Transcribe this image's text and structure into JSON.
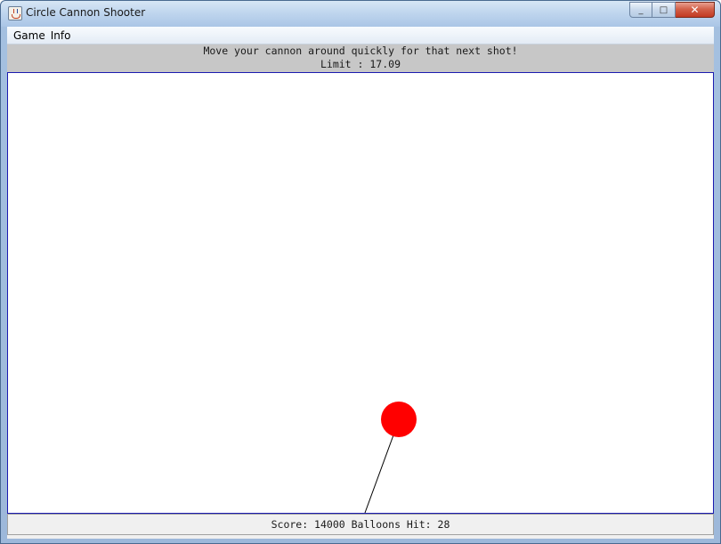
{
  "window": {
    "title": "Circle Cannon Shooter",
    "minimize_glyph": "_",
    "maximize_glyph": "□",
    "close_glyph": "✕"
  },
  "menu": {
    "items": [
      {
        "label": "Game"
      },
      {
        "label": "Info"
      }
    ]
  },
  "header": {
    "message": "Move your cannon around quickly for that next shot!",
    "limit_label": "Limit",
    "limit_value": "17.09",
    "limit_text": "Limit : 17.09"
  },
  "game": {
    "balloon_color": "#ff0000",
    "cannon_line_color": "#000000"
  },
  "footer": {
    "score_label": "Score:",
    "score_value": 14000,
    "balloons_hit_label": "Balloons Hit:",
    "balloons_hit_value": 28,
    "text": "Score: 14000 Balloons Hit: 28"
  }
}
